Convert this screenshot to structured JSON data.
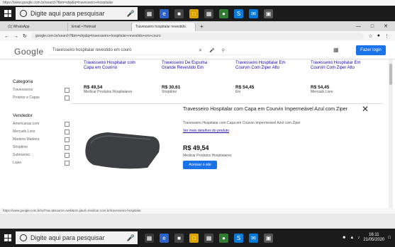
{
  "top_url": "https://www.google.com.br/search?tbm=shp&q=travesseiro+hospitalar",
  "taskbar": {
    "search_placeholder": "Digite aqui para pesquisar",
    "time": "16:11",
    "date": "21/05/2020"
  },
  "tabs": [
    {
      "label": "(1) WhatsApp"
    },
    {
      "label": "Email • Hotmail"
    },
    {
      "label": "Travesseiro hospitalar revestido"
    }
  ],
  "address": {
    "url": "google.com.br/search?tbm=shp&q=travesseiro+hospitalar+revestido+em+couro"
  },
  "google": {
    "logo": "Google",
    "query": "Travesseiro hospitalar revestido em couro",
    "signin_label": "Fazer login"
  },
  "sidebar": {
    "category_heading": "Categoria",
    "categories": [
      "Travesseiros",
      "Protetor e Capas"
    ],
    "sellers_heading": "Vendedor",
    "sellers": [
      "Americanas.com",
      "Mercado Livre",
      "Madeira Madeira",
      "Shoptime",
      "Submarino",
      "Lojas"
    ]
  },
  "products": [
    {
      "title": "Travesseiro Hospitalar com Capa em Courino",
      "price": "R$ 49,54",
      "store": "Medicar Produtos Hospitalares"
    },
    {
      "title": "Travesseiro De Espuma Grande Revestido Em",
      "price": "R$ 30,61",
      "store": "Shoptime"
    },
    {
      "title": "Travesseiro Hospitalar Em Courvin Com Ziper Alto",
      "price": "R$ 54,45",
      "store": "Elo"
    },
    {
      "title": "Travesseiro Hospitalar Em Courvin Com Ziper Alto",
      "price": "R$ 54,45",
      "store": "Mercado Livre"
    }
  ],
  "panel": {
    "title": "Travesseiro Hospitalar com Capa em Courvin Impermeável Azul com Ziper",
    "description": "Travesseiro Hospitalar com Capa em Courvin Impermeável Azul com Ziper",
    "link": "Ver mais detalhes do produto",
    "price": "R$ 49,54",
    "store": "Medicar Produtos Hospitalares",
    "button": "Acessar o site"
  },
  "statusbar": "https://www.google.com.br/url?sa=t&source=web&rct=j&url=medicar.com.br/travesseiro-hospitalar",
  "colors": {
    "accent": "#1a73e8",
    "link": "#1a0dab",
    "mat": "#3d3f42"
  }
}
